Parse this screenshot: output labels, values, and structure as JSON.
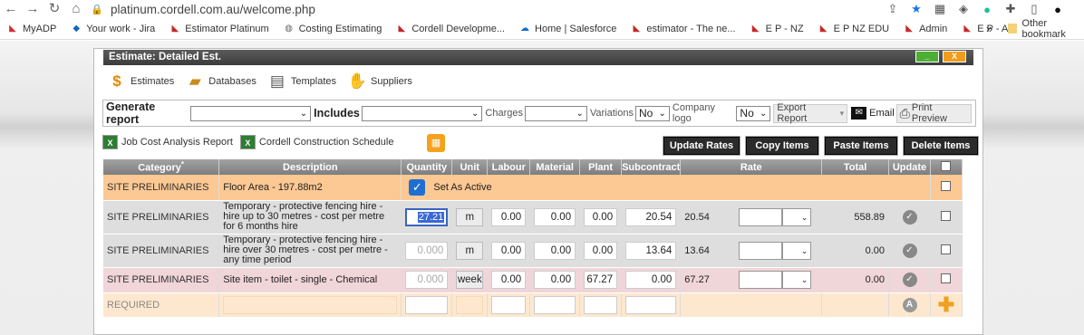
{
  "browser": {
    "url": "platinum.cordell.com.au/welcome.php"
  },
  "bookmarks": [
    {
      "label": "MyADP",
      "icon": "adp-icon",
      "color": "#d32f2f"
    },
    {
      "label": "Your work - Jira",
      "icon": "jira-icon",
      "color": "#1565c0"
    },
    {
      "label": "Estimator Platinum",
      "icon": "cordell-icon",
      "color": "#c62828"
    },
    {
      "label": "Costing Estimating",
      "icon": "globe-icon",
      "color": "#666666"
    },
    {
      "label": "Cordell Developme...",
      "icon": "cordell-icon",
      "color": "#c62828"
    },
    {
      "label": "Home | Salesforce",
      "icon": "cloud-icon",
      "color": "#0d6fd1"
    },
    {
      "label": "estimator - The ne...",
      "icon": "cordell-icon",
      "color": "#c62828"
    },
    {
      "label": "E P -  NZ",
      "icon": "cordell-icon",
      "color": "#c62828"
    },
    {
      "label": "E P NZ EDU",
      "icon": "cordell-icon",
      "color": "#c62828"
    },
    {
      "label": "Admin",
      "icon": "cordell-icon",
      "color": "#c62828"
    },
    {
      "label": "E P - AU",
      "icon": "cordell-icon",
      "color": "#c62828"
    }
  ],
  "bookmarks_overflow": "»",
  "other_bookmarks": "Other bookmark",
  "window": {
    "title": "Estimate: Detailed Est.",
    "min_label": "_",
    "close_label": "X"
  },
  "toolbar": [
    {
      "label": "Estimates",
      "icon": "dollar-icon"
    },
    {
      "label": "Databases",
      "icon": "folder-icon"
    },
    {
      "label": "Templates",
      "icon": "template-icon"
    },
    {
      "label": "Suppliers",
      "icon": "handshake-icon"
    }
  ],
  "report": {
    "generate_label": "Generate report",
    "includes_label": "Includes",
    "charges_label": "Charges",
    "variations_label": "Variations",
    "variations_value": "No",
    "company_logo_label": "Company logo",
    "company_logo_value": "No",
    "export_label": "Export Report",
    "email_label": "Email",
    "print_label": "Print Preview"
  },
  "links": {
    "job_cost": "Job Cost Analysis Report",
    "schedule": "Cordell Construction Schedule"
  },
  "actions": {
    "update_rates": "Update Rates",
    "copy_items": "Copy Items",
    "paste_items": "Paste Items",
    "delete_items": "Delete Items"
  },
  "columns": {
    "category": "Category",
    "category_marker": "*",
    "description": "Description",
    "quantity": "Quantity",
    "unit": "Unit",
    "labour": "Labour",
    "material": "Material",
    "plant": "Plant",
    "subcontract": "Subcontract",
    "rate": "Rate",
    "total": "Total",
    "update": "Update"
  },
  "section_row": {
    "category": "SITE PRELIMINARIES",
    "description": "Floor Area - 197.88m2",
    "set_active_label": "Set As Active"
  },
  "rows": [
    {
      "category": "SITE PRELIMINARIES",
      "description": "Temporary - protective fencing hire - hire up to 30 metres - cost per metre for 6 months hire",
      "quantity": "27.21",
      "unit": "m",
      "labour": "0.00",
      "material": "0.00",
      "plant": "0.00",
      "subcontract": "20.54",
      "rate": "20.54",
      "total": "558.89"
    },
    {
      "category": "SITE PRELIMINARIES",
      "description": "Temporary - protective fencing hire - hire over 30 metres - cost per metre - any time period",
      "quantity": "0.000",
      "unit": "m",
      "labour": "0.00",
      "material": "0.00",
      "plant": "0.00",
      "subcontract": "13.64",
      "rate": "13.64",
      "total": "0.00"
    },
    {
      "category": "SITE PRELIMINARIES",
      "description": "Site item - toilet - single - Chemical",
      "quantity": "0.000",
      "unit": "week",
      "labour": "0.00",
      "material": "0.00",
      "plant": "67.27",
      "subcontract": "0.00",
      "rate": "67.27",
      "total": "0.00"
    }
  ],
  "required_row": {
    "category": "REQUIRED",
    "badge": "A"
  }
}
